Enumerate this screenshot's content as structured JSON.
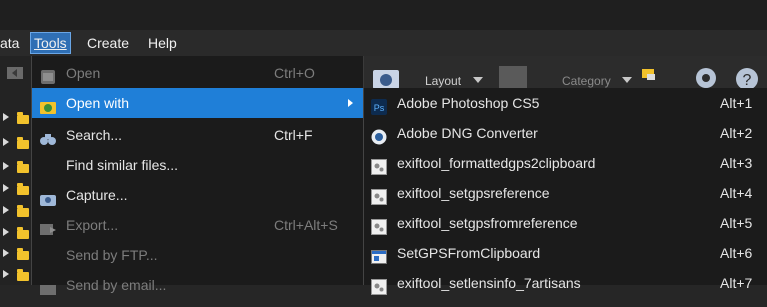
{
  "menubar": {
    "items": [
      {
        "label": "ata"
      },
      {
        "label": "Tools"
      },
      {
        "label": "Create"
      },
      {
        "label": "Help"
      }
    ]
  },
  "toolbar": {
    "layout_label": "Layout",
    "category_label": "Category"
  },
  "context_menu": {
    "items": [
      {
        "label": "Open",
        "shortcut": "Ctrl+O",
        "icon": "open-file-icon",
        "state": "disabled"
      },
      {
        "label": "Open with",
        "shortcut": "",
        "icon": "open-with-folder-icon",
        "state": "highlighted"
      },
      {
        "label": "Search...",
        "shortcut": "Ctrl+F",
        "icon": "binoculars-icon",
        "state": "normal"
      },
      {
        "label": "Find similar files...",
        "shortcut": "",
        "icon": "",
        "state": "normal"
      },
      {
        "label": "Capture...",
        "shortcut": "",
        "icon": "camera-icon",
        "state": "normal"
      },
      {
        "label": "Export...",
        "shortcut": "Ctrl+Alt+S",
        "icon": "export-icon",
        "state": "disabled"
      },
      {
        "label": "Send by FTP...",
        "shortcut": "",
        "icon": "",
        "state": "disabled"
      },
      {
        "label": "Send by email...",
        "shortcut": "",
        "icon": "email-icon",
        "state": "disabled"
      }
    ]
  },
  "submenu": {
    "items": [
      {
        "label": "Adobe Photoshop CS5",
        "shortcut": "Alt+1",
        "icon": "photoshop-icon"
      },
      {
        "label": "Adobe DNG Converter",
        "shortcut": "Alt+2",
        "icon": "dng-converter-icon"
      },
      {
        "label": "exiftool_formattedgps2clipboard",
        "shortcut": "Alt+3",
        "icon": "script-icon"
      },
      {
        "label": "exiftool_setgpsreference",
        "shortcut": "Alt+4",
        "icon": "script-icon"
      },
      {
        "label": "exiftool_setgpsfromreference",
        "shortcut": "Alt+5",
        "icon": "script-icon"
      },
      {
        "label": "SetGPSFromClipboard",
        "shortcut": "Alt+6",
        "icon": "app-window-icon"
      },
      {
        "label": "exiftool_setlensinfo_7artisans",
        "shortcut": "Alt+7",
        "icon": "script-icon"
      }
    ]
  },
  "colors": {
    "highlight": "#1f7fd8",
    "menu_bg": "#1b1b1b",
    "active_menubar": "#2f6fb5",
    "folder": "#f2c22c"
  }
}
